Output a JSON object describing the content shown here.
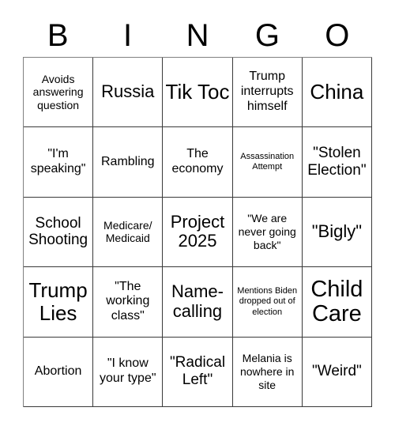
{
  "card": {
    "title": "BINGO Card",
    "header_letters": [
      "B",
      "I",
      "N",
      "G",
      "O"
    ],
    "grid_size": "5x5",
    "colors": {
      "text": "#000000",
      "background": "#ffffff",
      "grid_line": "#3a3a3a"
    },
    "rows": [
      [
        {
          "text": "Avoids answering question",
          "size": "fs-sm"
        },
        {
          "text": "Russia",
          "size": "fs-xl"
        },
        {
          "text": "Tik Toc",
          "size": "fs-xxl"
        },
        {
          "text": "Trump interrupts himself",
          "size": "fs-md"
        },
        {
          "text": "China",
          "size": "fs-xxl"
        }
      ],
      [
        {
          "text": "\"I'm speaking\"",
          "size": "fs-md"
        },
        {
          "text": "Rambling",
          "size": "fs-md"
        },
        {
          "text": "The economy",
          "size": "fs-md"
        },
        {
          "text": "Assassination Attempt",
          "size": "fs-xs"
        },
        {
          "text": "\"Stolen Election\"",
          "size": "fs-lg"
        }
      ],
      [
        {
          "text": "School Shooting",
          "size": "fs-lg"
        },
        {
          "text": "Medicare/ Medicaid",
          "size": "fs-sm"
        },
        {
          "text": "Project 2025",
          "size": "fs-xl"
        },
        {
          "text": "\"We are never going back\"",
          "size": "fs-sm"
        },
        {
          "text": "\"Bigly\"",
          "size": "fs-xl"
        }
      ],
      [
        {
          "text": "Trump Lies",
          "size": "fs-xxl"
        },
        {
          "text": "\"The working class\"",
          "size": "fs-md"
        },
        {
          "text": "Name-calling",
          "size": "fs-xl"
        },
        {
          "text": "Mentions Biden dropped out of election",
          "size": "fs-xs"
        },
        {
          "text": "Child Care",
          "size": "fs-xxxl"
        }
      ],
      [
        {
          "text": "Abortion",
          "size": "fs-md"
        },
        {
          "text": "\"I know your type\"",
          "size": "fs-md"
        },
        {
          "text": "\"Radical Left\"",
          "size": "fs-lg"
        },
        {
          "text": "Melania is nowhere in site",
          "size": "fs-sm"
        },
        {
          "text": "\"Weird\"",
          "size": "fs-lg"
        }
      ]
    ]
  }
}
